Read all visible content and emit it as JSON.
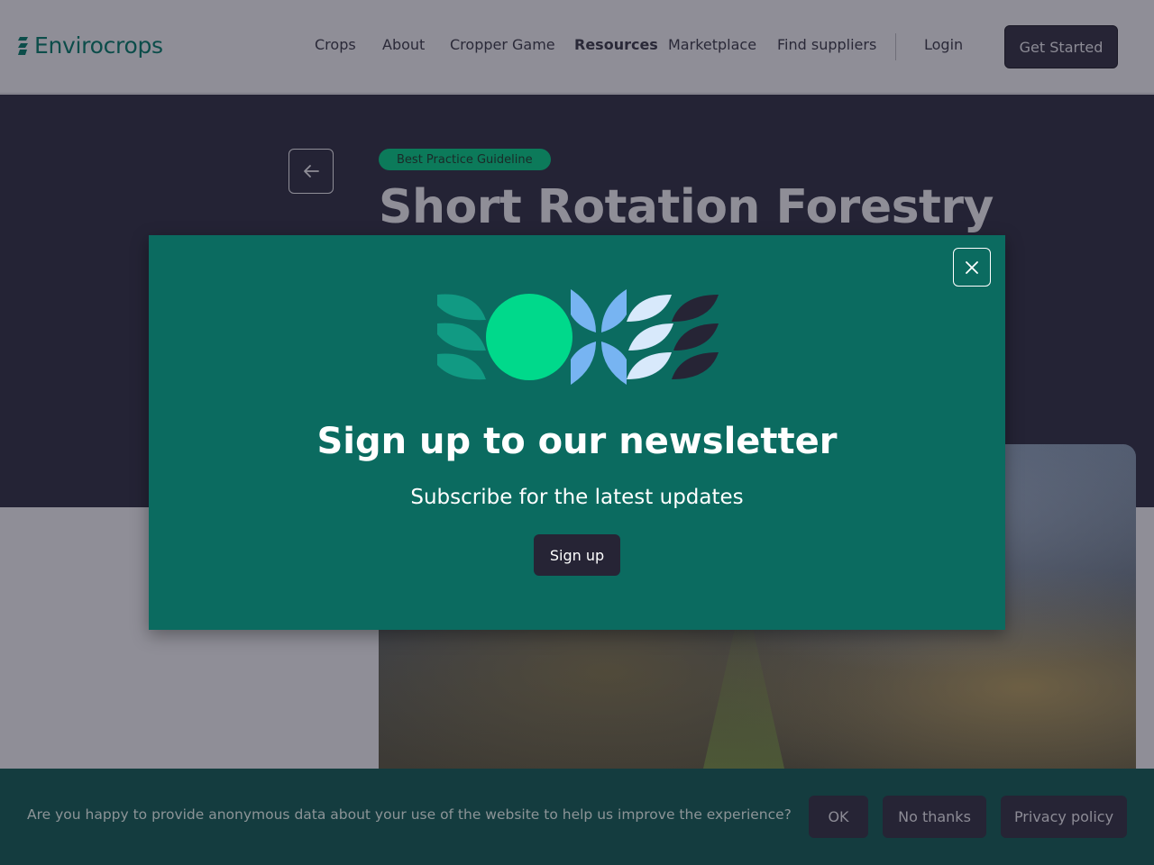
{
  "header": {
    "logo_text": "Envirocrops",
    "nav": [
      {
        "label": "Crops",
        "name": "nav-crops",
        "active": false
      },
      {
        "label": "About",
        "name": "nav-about",
        "active": false
      },
      {
        "label": "Cropper Game",
        "name": "nav-cropper-game",
        "active": false
      },
      {
        "label": "Resources",
        "name": "nav-resources",
        "active": true
      },
      {
        "label": "Marketplace",
        "name": "nav-marketplace",
        "active": false
      },
      {
        "label": "Find suppliers",
        "name": "nav-find-suppliers",
        "active": false
      }
    ],
    "login_label": "Login",
    "get_started_label": "Get Started"
  },
  "hero": {
    "badge": "Best Practice Guideline",
    "title": "Short Rotation Forestry"
  },
  "modal": {
    "title": "Sign up to our newsletter",
    "subtitle": "Subscribe for the latest updates",
    "signup_label": "Sign up"
  },
  "cookie_bar": {
    "text": "Are you happy to provide anonymous data about your use of the website to help us improve the experience?",
    "ok_label": "OK",
    "no_thanks_label": "No thanks",
    "privacy_label": "Privacy policy"
  },
  "colors": {
    "brand_dark": "#0c4d4a",
    "modal_bg": "#0b6b60",
    "hero_bg": "#242335",
    "button_dark": "#262435",
    "accent_green": "#00d98b",
    "accent_blue": "#77b4f2",
    "accent_light_blue": "#d8e9fb",
    "cookie_bg": "#143c3f"
  },
  "icons": {
    "logo": "leaf-logo-icon",
    "back": "arrow-left-icon",
    "close": "close-icon"
  }
}
